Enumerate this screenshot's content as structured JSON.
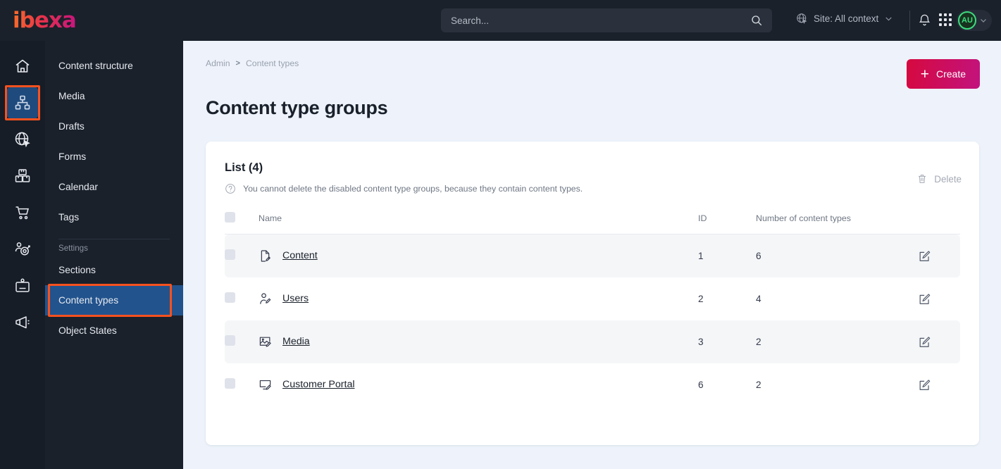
{
  "brand": {
    "logo_text": "ibexa",
    "accent_orange": "#f96e28",
    "accent_magenta": "#c5157f"
  },
  "topbar": {
    "search_placeholder": "Search...",
    "search_value": "",
    "context_label": "Site: All context",
    "avatar_initials": "AU"
  },
  "rail": {
    "items": [
      {
        "name": "home-icon",
        "label": "Dashboard",
        "active": false
      },
      {
        "name": "sitemap-icon",
        "label": "Content",
        "active": true
      },
      {
        "name": "globe-pointer-icon",
        "label": "Site",
        "active": false
      },
      {
        "name": "boxes-icon",
        "label": "Product catalog",
        "active": false
      },
      {
        "name": "cart-icon",
        "label": "Commerce",
        "active": false
      },
      {
        "name": "target-user-icon",
        "label": "Personalization",
        "active": false
      },
      {
        "name": "id-card-icon",
        "label": "Customers",
        "active": false
      },
      {
        "name": "megaphone-icon",
        "label": "Campaigns",
        "active": false
      }
    ]
  },
  "sidebar": {
    "items": [
      {
        "label": "Content structure",
        "active": false
      },
      {
        "label": "Media",
        "active": false
      },
      {
        "label": "Drafts",
        "active": false
      },
      {
        "label": "Forms",
        "active": false
      },
      {
        "label": "Calendar",
        "active": false
      },
      {
        "label": "Tags",
        "active": false
      }
    ],
    "settings_label": "Settings",
    "settings_items": [
      {
        "label": "Sections",
        "active": false
      },
      {
        "label": "Content types",
        "active": true
      },
      {
        "label": "Object States",
        "active": false
      }
    ]
  },
  "main": {
    "breadcrumb": {
      "root": "Admin",
      "separator": ">",
      "current": "Content types"
    },
    "page_title": "Content type groups",
    "create_label": "Create",
    "card": {
      "list_title": "List (4)",
      "note": "You cannot delete the disabled content type groups, because they contain content types.",
      "delete_label": "Delete",
      "columns": [
        "",
        "Name",
        "ID",
        "Number of content types",
        ""
      ],
      "rows": [
        {
          "name": "Content",
          "id": "1",
          "count": "6",
          "icon": "file-edit-icon",
          "alt": true
        },
        {
          "name": "Users",
          "id": "2",
          "count": "4",
          "icon": "user-edit-icon",
          "alt": false
        },
        {
          "name": "Media",
          "id": "3",
          "count": "2",
          "icon": "image-edit-icon",
          "alt": true
        },
        {
          "name": "Customer Portal",
          "id": "6",
          "count": "2",
          "icon": "monitor-edit-icon",
          "alt": false
        }
      ]
    }
  },
  "annotations": {
    "highlight_color": "#f8511e"
  }
}
